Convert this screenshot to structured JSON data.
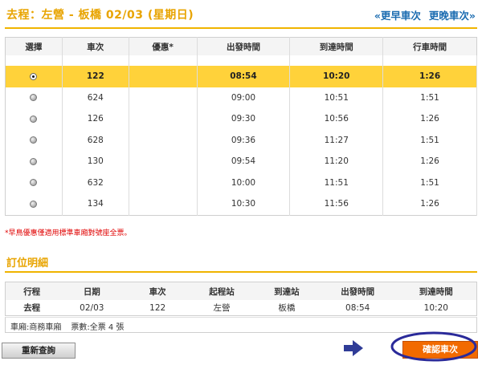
{
  "header": {
    "title": "去程：左營 - 板橋 02/03 (星期日)",
    "earlier_link": "«更早車次",
    "later_link": "更晚車次»"
  },
  "trains": {
    "columns": [
      "選擇",
      "車次",
      "優惠*",
      "出發時間",
      "到達時間",
      "行車時間"
    ],
    "rows": [
      {
        "train": "122",
        "discount": "",
        "depart": "08:54",
        "arrive": "10:20",
        "duration": "1:26",
        "selected": true
      },
      {
        "train": "624",
        "discount": "",
        "depart": "09:00",
        "arrive": "10:51",
        "duration": "1:51",
        "selected": false
      },
      {
        "train": "126",
        "discount": "",
        "depart": "09:30",
        "arrive": "10:56",
        "duration": "1:26",
        "selected": false
      },
      {
        "train": "628",
        "discount": "",
        "depart": "09:36",
        "arrive": "11:27",
        "duration": "1:51",
        "selected": false
      },
      {
        "train": "130",
        "discount": "",
        "depart": "09:54",
        "arrive": "11:20",
        "duration": "1:26",
        "selected": false
      },
      {
        "train": "632",
        "discount": "",
        "depart": "10:00",
        "arrive": "11:51",
        "duration": "1:51",
        "selected": false
      },
      {
        "train": "134",
        "discount": "",
        "depart": "10:30",
        "arrive": "11:56",
        "duration": "1:26",
        "selected": false
      }
    ]
  },
  "note": "*早鳥優惠僅適用標準車廂對號座全票。",
  "booking": {
    "section_title": "訂位明細",
    "columns": [
      "行程",
      "日期",
      "車次",
      "起程站",
      "到達站",
      "出發時間",
      "到達時間"
    ],
    "row": {
      "trip": "去程",
      "date": "02/03",
      "train": "122",
      "from": "左營",
      "to": "板橋",
      "depart": "08:54",
      "arrive": "10:20"
    },
    "car_label": "車廂:商務車廂",
    "ticket_label": "票數:全票 4 張"
  },
  "buttons": {
    "requery": "重新查詢",
    "confirm": "確認車次"
  },
  "colors": {
    "accent_yellow": "#ffd23a",
    "title_gold": "#e8a400",
    "link_blue": "#1a6bb0",
    "confirm_orange": "#f26a00",
    "note_red": "#e00000",
    "highlight_ellipse": "#2a2a9a"
  },
  "icons": {
    "arrow": "right-arrow-icon",
    "radio": "radio-button"
  }
}
